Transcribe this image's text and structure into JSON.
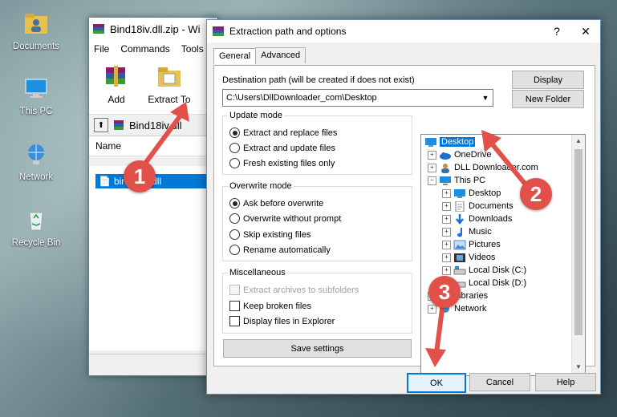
{
  "desktop": {
    "icons": [
      {
        "label": "Documents"
      },
      {
        "label": "This PC"
      },
      {
        "label": "Network"
      },
      {
        "label": "Recycle Bin"
      }
    ]
  },
  "winrar": {
    "title": "Bind18iv.dll.zip - Wi",
    "menu": [
      "File",
      "Commands",
      "Tools"
    ],
    "toolbar": {
      "add": "Add",
      "extract_to": "Extract To"
    },
    "path": "Bind18iv.dll",
    "list_header": "Name",
    "selected_file": "bind18iv.dll"
  },
  "dialog": {
    "title": "Extraction path and options",
    "help_glyph": "?",
    "close_glyph": "✕",
    "tabs": [
      "General",
      "Advanced"
    ],
    "destination_label": "Destination path (will be created if does not exist)",
    "destination_value": "C:\\Users\\DllDownloader_com\\Desktop",
    "display_button": "Display",
    "new_folder_button": "New Folder",
    "update_mode": {
      "title": "Update mode",
      "options": [
        "Extract and replace files",
        "Extract and update files",
        "Fresh existing files only"
      ],
      "selected": 0
    },
    "overwrite_mode": {
      "title": "Overwrite mode",
      "options": [
        "Ask before overwrite",
        "Overwrite without prompt",
        "Skip existing files",
        "Rename automatically"
      ],
      "selected": 0
    },
    "misc": {
      "title": "Miscellaneous",
      "options": [
        "Extract archives to subfolders",
        "Keep broken files",
        "Display files in Explorer"
      ]
    },
    "save_settings": "Save settings",
    "tree": [
      {
        "label": "Desktop",
        "selected": true
      },
      {
        "label": "OneDrive"
      },
      {
        "label": "DLL Downloader.com"
      },
      {
        "label": "This PC"
      },
      {
        "label": "Desktop"
      },
      {
        "label": "Documents"
      },
      {
        "label": "Downloads"
      },
      {
        "label": "Music"
      },
      {
        "label": "Pictures"
      },
      {
        "label": "Videos"
      },
      {
        "label": "Local Disk (C:)"
      },
      {
        "label": "Local Disk (D:)"
      },
      {
        "label": "Libraries"
      },
      {
        "label": "Network"
      }
    ],
    "ok_button": "OK",
    "cancel_button": "Cancel",
    "help_button": "Help"
  },
  "annotations": [
    "1",
    "2",
    "3"
  ],
  "colors": {
    "accent": "#0078d7",
    "annotation": "#e2504a"
  }
}
